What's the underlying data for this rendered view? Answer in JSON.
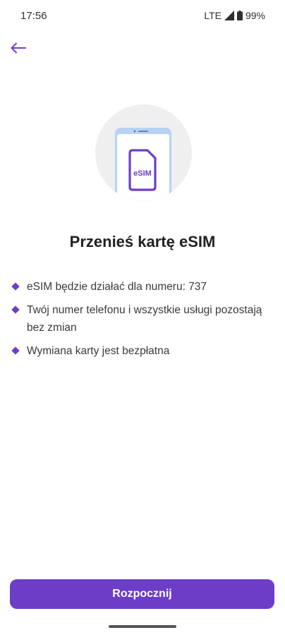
{
  "status_bar": {
    "time": "17:56",
    "network": "LTE",
    "battery": "99%"
  },
  "icons": {
    "back": "arrow-left-icon",
    "signal": "signal-icon",
    "battery": "battery-icon",
    "sim": "esim-card-icon",
    "bullet": "diamond-bullet-icon"
  },
  "hero": {
    "sim_label": "eSIM"
  },
  "title": "Przenieś kartę eSIM",
  "bullets": [
    "eSIM będzie działać dla numeru: 737",
    "Twój numer telefonu i wszystkie usługi pozostają bez zmian",
    "Wymiana karty jest bezpłatna"
  ],
  "primary_button": {
    "label": "Rozpocznij"
  },
  "colors": {
    "accent": "#6c3ec8",
    "text": "#222222",
    "hero_circle": "#efefef",
    "phone_frame": "#b8d2f5"
  }
}
